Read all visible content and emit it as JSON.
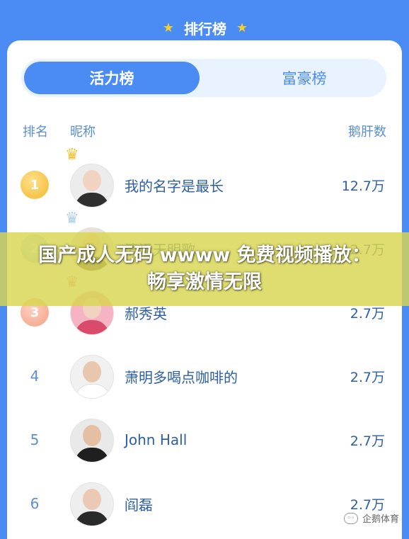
{
  "header": {
    "title": "排行榜"
  },
  "tabs": [
    {
      "label": "活力榜",
      "active": true
    },
    {
      "label": "富豪榜",
      "active": false
    }
  ],
  "columns": {
    "rank": "排名",
    "nickname": "昵称",
    "score": "鹅肝数"
  },
  "rows": [
    {
      "rank": "1",
      "name": "我的名字是最长",
      "value": "12.7万",
      "medal": "gold"
    },
    {
      "rank": "2",
      "name": "清泽天明歌",
      "value": "2.7万",
      "medal": "silver"
    },
    {
      "rank": "3",
      "name": "郝秀英",
      "value": "2.7万",
      "medal": "bronze"
    },
    {
      "rank": "4",
      "name": "萧明多喝点咖啡的",
      "value": "2.7万",
      "medal": ""
    },
    {
      "rank": "5",
      "name": "John Hall",
      "value": "2.7万",
      "medal": ""
    },
    {
      "rank": "6",
      "name": "阎磊",
      "value": "2.7万",
      "medal": ""
    }
  ],
  "overlay": {
    "text": "国产成人无码 wwww 免费视频播放：畅享激情无限"
  },
  "watermark": {
    "text": "企鹅体育"
  },
  "colors": {
    "primary": "#4a8cf3",
    "text": "#2d5fa8",
    "star": "#f6cf2a"
  }
}
